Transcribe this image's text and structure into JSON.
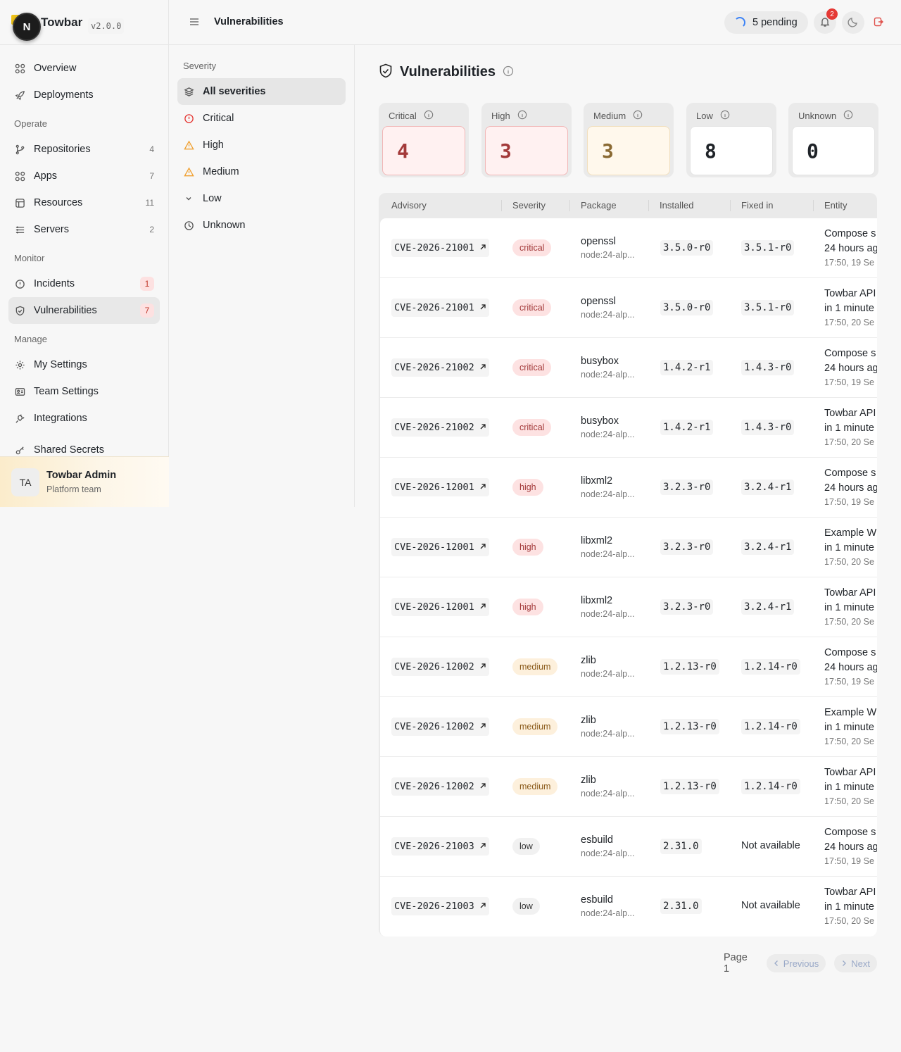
{
  "brand": {
    "name": "Towbar",
    "version": "v2.0.0",
    "avatar_letter": "N"
  },
  "nav": {
    "top": [
      {
        "label": "Overview",
        "icon": "grid-icon"
      },
      {
        "label": "Deployments",
        "icon": "rocket-icon"
      }
    ],
    "operate_title": "Operate",
    "operate": [
      {
        "label": "Repositories",
        "count": "4",
        "icon": "branch-icon"
      },
      {
        "label": "Apps",
        "count": "7",
        "icon": "grid-icon"
      },
      {
        "label": "Resources",
        "count": "11",
        "icon": "database-icon"
      },
      {
        "label": "Servers",
        "count": "2",
        "icon": "server-icon"
      }
    ],
    "monitor_title": "Monitor",
    "monitor": [
      {
        "label": "Incidents",
        "count": "1",
        "icon": "alert-circle-icon"
      },
      {
        "label": "Vulnerabilities",
        "count": "7",
        "icon": "shield-icon"
      }
    ],
    "manage_title": "Manage",
    "manage": [
      {
        "label": "My Settings",
        "icon": "gear-icon"
      },
      {
        "label": "Team Settings",
        "icon": "id-card-icon"
      },
      {
        "label": "Integrations",
        "icon": "plug-icon"
      },
      {
        "label": "Shared Secrets",
        "icon": "key-icon"
      }
    ]
  },
  "user": {
    "initials": "TA",
    "name": "Towbar Admin",
    "team": "Platform team"
  },
  "topbar": {
    "title": "Vulnerabilities",
    "pending": "5 pending",
    "notifications": "2"
  },
  "filters": {
    "title": "Severity",
    "items": [
      {
        "label": "All severities",
        "icon": "layers-icon"
      },
      {
        "label": "Critical",
        "icon": "alert-circle-icon",
        "color": "#e53935"
      },
      {
        "label": "High",
        "icon": "warning-triangle-icon",
        "color": "#f0a030"
      },
      {
        "label": "Medium",
        "icon": "warning-triangle-icon",
        "color": "#f0a030"
      },
      {
        "label": "Low",
        "icon": "chevron-down-icon"
      },
      {
        "label": "Unknown",
        "icon": "clock-icon"
      }
    ]
  },
  "page": {
    "title": "Vulnerabilities"
  },
  "summary": [
    {
      "label": "Critical",
      "value": "4"
    },
    {
      "label": "High",
      "value": "3"
    },
    {
      "label": "Medium",
      "value": "3"
    },
    {
      "label": "Low",
      "value": "8"
    },
    {
      "label": "Unknown",
      "value": "0"
    }
  ],
  "table": {
    "headers": [
      "Advisory",
      "Severity",
      "Package",
      "Installed",
      "Fixed in",
      "Entity"
    ],
    "rows": [
      {
        "advisory": "CVE-2026-21001",
        "severity": "critical",
        "package": "openssl",
        "image": "node:24-alp...",
        "installed": "3.5.0-r0",
        "fixed": "3.5.1-r0",
        "entity": "Compose s",
        "entity2": "24 hours ag",
        "time": "17:50, 19 Se"
      },
      {
        "advisory": "CVE-2026-21001",
        "severity": "critical",
        "package": "openssl",
        "image": "node:24-alp...",
        "installed": "3.5.0-r0",
        "fixed": "3.5.1-r0",
        "entity": "Towbar API",
        "entity2": "in 1 minute",
        "time": "17:50, 20 Se"
      },
      {
        "advisory": "CVE-2026-21002",
        "severity": "critical",
        "package": "busybox",
        "image": "node:24-alp...",
        "installed": "1.4.2-r1",
        "fixed": "1.4.3-r0",
        "entity": "Compose s",
        "entity2": "24 hours ag",
        "time": "17:50, 19 Se"
      },
      {
        "advisory": "CVE-2026-21002",
        "severity": "critical",
        "package": "busybox",
        "image": "node:24-alp...",
        "installed": "1.4.2-r1",
        "fixed": "1.4.3-r0",
        "entity": "Towbar API",
        "entity2": "in 1 minute",
        "time": "17:50, 20 Se"
      },
      {
        "advisory": "CVE-2026-12001",
        "severity": "high",
        "package": "libxml2",
        "image": "node:24-alp...",
        "installed": "3.2.3-r0",
        "fixed": "3.2.4-r1",
        "entity": "Compose s",
        "entity2": "24 hours ag",
        "time": "17:50, 19 Se"
      },
      {
        "advisory": "CVE-2026-12001",
        "severity": "high",
        "package": "libxml2",
        "image": "node:24-alp...",
        "installed": "3.2.3-r0",
        "fixed": "3.2.4-r1",
        "entity": "Example W",
        "entity2": "in 1 minute",
        "time": "17:50, 20 Se"
      },
      {
        "advisory": "CVE-2026-12001",
        "severity": "high",
        "package": "libxml2",
        "image": "node:24-alp...",
        "installed": "3.2.3-r0",
        "fixed": "3.2.4-r1",
        "entity": "Towbar API",
        "entity2": "in 1 minute",
        "time": "17:50, 20 Se"
      },
      {
        "advisory": "CVE-2026-12002",
        "severity": "medium",
        "package": "zlib",
        "image": "node:24-alp...",
        "installed": "1.2.13-r0",
        "fixed": "1.2.14-r0",
        "entity": "Compose s",
        "entity2": "24 hours ag",
        "time": "17:50, 19 Se"
      },
      {
        "advisory": "CVE-2026-12002",
        "severity": "medium",
        "package": "zlib",
        "image": "node:24-alp...",
        "installed": "1.2.13-r0",
        "fixed": "1.2.14-r0",
        "entity": "Example W",
        "entity2": "in 1 minute",
        "time": "17:50, 20 Se"
      },
      {
        "advisory": "CVE-2026-12002",
        "severity": "medium",
        "package": "zlib",
        "image": "node:24-alp...",
        "installed": "1.2.13-r0",
        "fixed": "1.2.14-r0",
        "entity": "Towbar API",
        "entity2": "in 1 minute",
        "time": "17:50, 20 Se"
      },
      {
        "advisory": "CVE-2026-21003",
        "severity": "low",
        "package": "esbuild",
        "image": "node:24-alp...",
        "installed": "2.31.0",
        "fixed": "Not available",
        "entity": "Compose s",
        "entity2": "24 hours ag",
        "time": "17:50, 19 Se"
      },
      {
        "advisory": "CVE-2026-21003",
        "severity": "low",
        "package": "esbuild",
        "image": "node:24-alp...",
        "installed": "2.31.0",
        "fixed": "Not available",
        "entity": "Towbar API",
        "entity2": "in 1 minute",
        "time": "17:50, 20 Se"
      }
    ]
  },
  "pager": {
    "label": "Page 1",
    "previous": "Previous",
    "next": "Next"
  }
}
